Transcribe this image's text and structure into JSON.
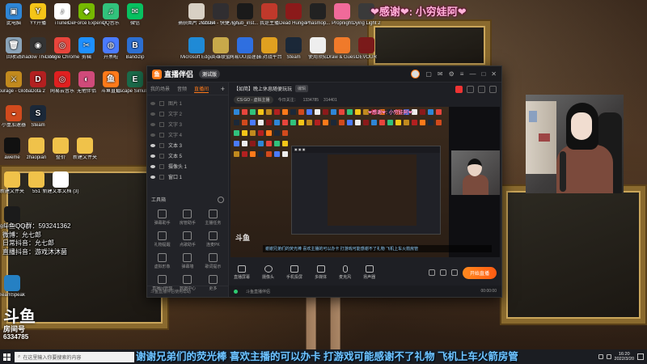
{
  "desktop_icons": [
    {
      "label": "此电脑",
      "color": "#2f86d6",
      "glyph": "▣"
    },
    {
      "label": "YY开播",
      "color": "#f5c518",
      "glyph": "Y"
    },
    {
      "label": "iTunes",
      "color": "#ffffff",
      "glyph": "♪"
    },
    {
      "label": "GeForce Experience",
      "color": "#76b900",
      "glyph": "◆"
    },
    {
      "label": "QQ音乐",
      "color": "#31c27c",
      "glyph": "♫"
    },
    {
      "label": "微信",
      "color": "#07c160",
      "glyph": "✉"
    },
    {
      "label": "回收站",
      "color": "#8aa3b8",
      "glyph": "🗑"
    },
    {
      "label": "Shadow The Wine Sour...",
      "color": "#333333",
      "glyph": "◉"
    },
    {
      "label": "Google Chrome",
      "color": "#e8453c",
      "glyph": "◎"
    },
    {
      "label": "剪辑",
      "color": "#1e90ff",
      "glyph": "✂"
    },
    {
      "label": "开黑啦",
      "color": "#4a7bff",
      "glyph": "◍"
    },
    {
      "label": "Bandizip",
      "color": "#2c6fd1",
      "glyph": "B"
    },
    {
      "label": "Courage - Global Off...",
      "color": "#c28a1e",
      "glyph": "⚔"
    },
    {
      "label": "Dota 2",
      "color": "#b32020",
      "glyph": "D"
    },
    {
      "label": "网易云音乐",
      "color": "#e02020",
      "glyph": "◎"
    },
    {
      "label": "无他伴侣",
      "color": "#d04a7a",
      "glyph": "◐"
    },
    {
      "label": "斗鱼直播",
      "color": "#ff7a1a",
      "glyph": "鱼"
    },
    {
      "label": "Escape Simulator",
      "color": "#1b6b4a",
      "glyph": "E"
    },
    {
      "label": "小盒加速器",
      "color": "#d14a1d",
      "glyph": "◒"
    },
    {
      "label": "Steam",
      "color": "#1b2838",
      "glyph": "S"
    }
  ],
  "top_icons": [
    {
      "label": "捕获图片 2021111...",
      "color": "#d8d0c4"
    },
    {
      "label": "obs64 - 快捷方式",
      "color": "#302e31"
    },
    {
      "label": "lghub_inst...",
      "color": "#1a1a1a"
    },
    {
      "label": "我是主播",
      "color": "#c0392b"
    },
    {
      "label": "Dead Hunger",
      "color": "#8b1a1a"
    },
    {
      "label": "Phasmop...",
      "color": "#222222"
    },
    {
      "label": "Propnight",
      "color": "#f06a9a"
    },
    {
      "label": "Dying Light 2",
      "color": "#3a3a3a"
    }
  ],
  "top_icons_row2": [
    {
      "label": "Microsoft Edge",
      "color": "#1f8ad6"
    },
    {
      "label": "英雄联盟",
      "color": "#c8a94a"
    },
    {
      "label": "网易UU加速器",
      "color": "#2f6fe0"
    },
    {
      "label": "5E对战平台",
      "color": "#e0a020"
    },
    {
      "label": "Steam",
      "color": "#1b2838"
    },
    {
      "label": "使用须知",
      "color": "#eeeeee"
    },
    {
      "label": "Draw & Guess",
      "color": "#f07a2a"
    },
    {
      "label": "DEVOUR",
      "color": "#7a1a1a"
    }
  ],
  "left_col_icons": [
    {
      "label": "aweme",
      "color": "#111111"
    },
    {
      "label": "zhaopian",
      "color": "#f0c24a"
    },
    {
      "label": "整价",
      "color": "#f0c24a"
    },
    {
      "label": "新建文件夹",
      "color": "#f0c24a"
    },
    {
      "label": "新建文件夹",
      "color": "#f0c24a"
    },
    {
      "label": "551",
      "color": "#f0c24a"
    },
    {
      "label": "新建文本文档 (3)",
      "color": "#ffffff"
    },
    {
      "label": "Logitech G HUB",
      "color": "#1b1b1b"
    },
    {
      "label": "TeamSpeak",
      "color": "#2580c3"
    }
  ],
  "overlay_thanks": "❤感谢❤: 小穷娃阿❤",
  "streamer_info": [
    "斗鱼QQ群：593241362",
    "微博：允七郎",
    "日常抖音：允七郎",
    "直播抖音：游戏沐沐菌"
  ],
  "douyu_logo": {
    "big": "斗鱼",
    "small": "房间号",
    "room": "6334785"
  },
  "ticker_text": "谢谢兄弟们的荧光棒  喜欢主播的可以办卡  打游戏可能感谢不了礼物    飞机上车火箭房管",
  "app": {
    "name": "直播伴侣",
    "badge": "测试版",
    "side_tabs": [
      "我的场景",
      "音频",
      "直播间",
      "+"
    ],
    "scenes": [
      {
        "label": "图片 1",
        "on": false
      },
      {
        "label": "文字 2",
        "on": false
      },
      {
        "label": "文字 3",
        "on": false
      },
      {
        "label": "文字 4",
        "on": false
      },
      {
        "label": "文本 3",
        "on": true
      },
      {
        "label": "文本 5",
        "on": true
      },
      {
        "label": "摄像头 1",
        "on": true
      },
      {
        "label": "窗口 1",
        "on": true
      }
    ],
    "tools_title": "工具箱",
    "tools": [
      "弹幕助手",
      "房管助手",
      "主播任务",
      "礼物提醒",
      "点歌助手",
      "连麦PK",
      "虚拟形象",
      "弹幕墙",
      "歌词提示",
      "直播间管理",
      "数据中心",
      "更多"
    ],
    "footer": "斗鱼直播伴侣使用帮助",
    "room_title": "【如简】晚上休息随便玩玩",
    "room_tag": "编辑",
    "category": "CS:GO - 虚拟主播",
    "fan_label": "今日关注：",
    "fan_count": "1334785",
    "hot": "314401",
    "controls": [
      "直播屏幕",
      "摄像头",
      "手机投屏",
      "多媒体",
      "麦克风",
      "扬声器"
    ],
    "go_live": "开始直播",
    "status_left": "斗鱼直播伴侣",
    "status_time": "00:00:00"
  },
  "taskbar": {
    "search_placeholder": "在这里输入你要搜索的内容",
    "time": "16:20",
    "date": "2022/3/20"
  }
}
